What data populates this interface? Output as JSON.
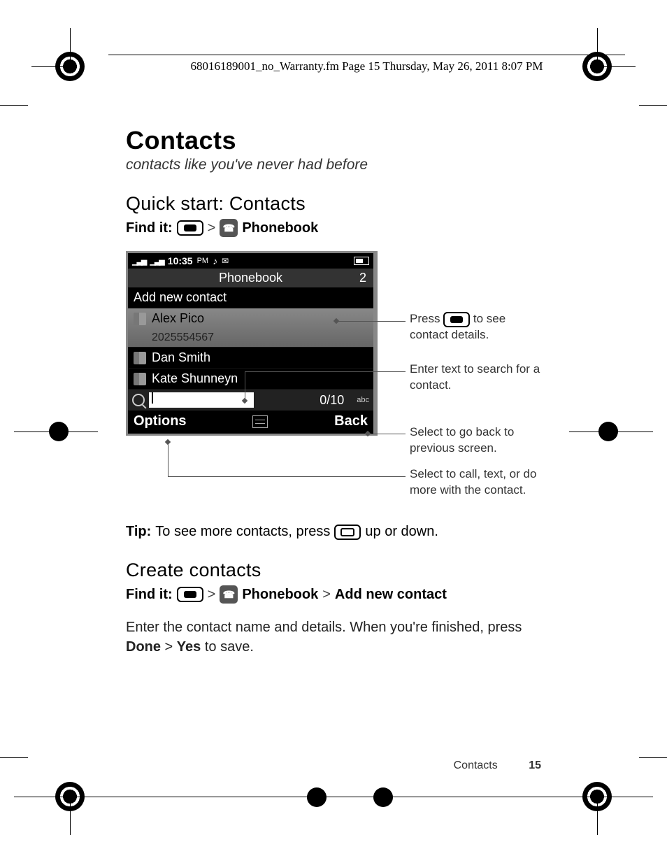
{
  "header_running": "68016189001_no_Warranty.fm  Page 15  Thursday, May 26, 2011  8:07 PM",
  "h1": "Contacts",
  "subtitle": "contacts like you've never had before",
  "quickstart": {
    "heading": "Quick start: Contacts",
    "findit_label": "Find it:",
    "breadcrumb_sep": ">",
    "phonebook_label": "Phonebook"
  },
  "phone": {
    "time": "10:35",
    "ampm": "PM",
    "title": "Phonebook",
    "count": "2",
    "add_new": "Add new contact",
    "contacts": [
      {
        "name": "Alex Pico",
        "number": "2025554567",
        "selected": true
      },
      {
        "name": "Dan Smith",
        "selected": false
      },
      {
        "name": "Kate Shunneyn",
        "selected": false
      }
    ],
    "search_count": "0/10",
    "abc": "abc",
    "softkey_left": "Options",
    "softkey_right": "Back"
  },
  "callouts": {
    "c1a": "Press ",
    "c1b": " to see contact details.",
    "c2": "Enter text to search for a contact.",
    "c3": "Select to go back to previous screen.",
    "c4": "Select to call, text, or do more with the contact."
  },
  "tip": {
    "label": "Tip:",
    "before": "To see more contacts, press ",
    "after": " up or down."
  },
  "create": {
    "heading": "Create contacts",
    "findit_label": "Find it:",
    "phonebook_label": "Phonebook",
    "addnew_label": "Add new contact",
    "body_a": "Enter the contact name and details. When you're finished, press ",
    "done": "Done",
    "sep": " > ",
    "yes": "Yes",
    "body_b": " to save."
  },
  "footer": {
    "section": "Contacts",
    "page": "15"
  }
}
